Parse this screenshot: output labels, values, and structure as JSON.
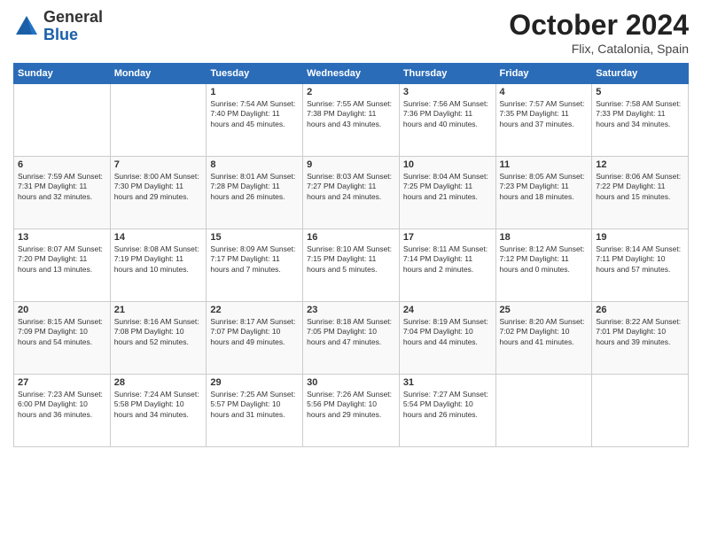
{
  "header": {
    "logo_general": "General",
    "logo_blue": "Blue",
    "month": "October 2024",
    "location": "Flix, Catalonia, Spain"
  },
  "weekdays": [
    "Sunday",
    "Monday",
    "Tuesday",
    "Wednesday",
    "Thursday",
    "Friday",
    "Saturday"
  ],
  "weeks": [
    [
      {
        "day": "",
        "info": ""
      },
      {
        "day": "",
        "info": ""
      },
      {
        "day": "1",
        "info": "Sunrise: 7:54 AM\nSunset: 7:40 PM\nDaylight: 11 hours and 45 minutes."
      },
      {
        "day": "2",
        "info": "Sunrise: 7:55 AM\nSunset: 7:38 PM\nDaylight: 11 hours and 43 minutes."
      },
      {
        "day": "3",
        "info": "Sunrise: 7:56 AM\nSunset: 7:36 PM\nDaylight: 11 hours and 40 minutes."
      },
      {
        "day": "4",
        "info": "Sunrise: 7:57 AM\nSunset: 7:35 PM\nDaylight: 11 hours and 37 minutes."
      },
      {
        "day": "5",
        "info": "Sunrise: 7:58 AM\nSunset: 7:33 PM\nDaylight: 11 hours and 34 minutes."
      }
    ],
    [
      {
        "day": "6",
        "info": "Sunrise: 7:59 AM\nSunset: 7:31 PM\nDaylight: 11 hours and 32 minutes."
      },
      {
        "day": "7",
        "info": "Sunrise: 8:00 AM\nSunset: 7:30 PM\nDaylight: 11 hours and 29 minutes."
      },
      {
        "day": "8",
        "info": "Sunrise: 8:01 AM\nSunset: 7:28 PM\nDaylight: 11 hours and 26 minutes."
      },
      {
        "day": "9",
        "info": "Sunrise: 8:03 AM\nSunset: 7:27 PM\nDaylight: 11 hours and 24 minutes."
      },
      {
        "day": "10",
        "info": "Sunrise: 8:04 AM\nSunset: 7:25 PM\nDaylight: 11 hours and 21 minutes."
      },
      {
        "day": "11",
        "info": "Sunrise: 8:05 AM\nSunset: 7:23 PM\nDaylight: 11 hours and 18 minutes."
      },
      {
        "day": "12",
        "info": "Sunrise: 8:06 AM\nSunset: 7:22 PM\nDaylight: 11 hours and 15 minutes."
      }
    ],
    [
      {
        "day": "13",
        "info": "Sunrise: 8:07 AM\nSunset: 7:20 PM\nDaylight: 11 hours and 13 minutes."
      },
      {
        "day": "14",
        "info": "Sunrise: 8:08 AM\nSunset: 7:19 PM\nDaylight: 11 hours and 10 minutes."
      },
      {
        "day": "15",
        "info": "Sunrise: 8:09 AM\nSunset: 7:17 PM\nDaylight: 11 hours and 7 minutes."
      },
      {
        "day": "16",
        "info": "Sunrise: 8:10 AM\nSunset: 7:15 PM\nDaylight: 11 hours and 5 minutes."
      },
      {
        "day": "17",
        "info": "Sunrise: 8:11 AM\nSunset: 7:14 PM\nDaylight: 11 hours and 2 minutes."
      },
      {
        "day": "18",
        "info": "Sunrise: 8:12 AM\nSunset: 7:12 PM\nDaylight: 11 hours and 0 minutes."
      },
      {
        "day": "19",
        "info": "Sunrise: 8:14 AM\nSunset: 7:11 PM\nDaylight: 10 hours and 57 minutes."
      }
    ],
    [
      {
        "day": "20",
        "info": "Sunrise: 8:15 AM\nSunset: 7:09 PM\nDaylight: 10 hours and 54 minutes."
      },
      {
        "day": "21",
        "info": "Sunrise: 8:16 AM\nSunset: 7:08 PM\nDaylight: 10 hours and 52 minutes."
      },
      {
        "day": "22",
        "info": "Sunrise: 8:17 AM\nSunset: 7:07 PM\nDaylight: 10 hours and 49 minutes."
      },
      {
        "day": "23",
        "info": "Sunrise: 8:18 AM\nSunset: 7:05 PM\nDaylight: 10 hours and 47 minutes."
      },
      {
        "day": "24",
        "info": "Sunrise: 8:19 AM\nSunset: 7:04 PM\nDaylight: 10 hours and 44 minutes."
      },
      {
        "day": "25",
        "info": "Sunrise: 8:20 AM\nSunset: 7:02 PM\nDaylight: 10 hours and 41 minutes."
      },
      {
        "day": "26",
        "info": "Sunrise: 8:22 AM\nSunset: 7:01 PM\nDaylight: 10 hours and 39 minutes."
      }
    ],
    [
      {
        "day": "27",
        "info": "Sunrise: 7:23 AM\nSunset: 6:00 PM\nDaylight: 10 hours and 36 minutes."
      },
      {
        "day": "28",
        "info": "Sunrise: 7:24 AM\nSunset: 5:58 PM\nDaylight: 10 hours and 34 minutes."
      },
      {
        "day": "29",
        "info": "Sunrise: 7:25 AM\nSunset: 5:57 PM\nDaylight: 10 hours and 31 minutes."
      },
      {
        "day": "30",
        "info": "Sunrise: 7:26 AM\nSunset: 5:56 PM\nDaylight: 10 hours and 29 minutes."
      },
      {
        "day": "31",
        "info": "Sunrise: 7:27 AM\nSunset: 5:54 PM\nDaylight: 10 hours and 26 minutes."
      },
      {
        "day": "",
        "info": ""
      },
      {
        "day": "",
        "info": ""
      }
    ]
  ]
}
